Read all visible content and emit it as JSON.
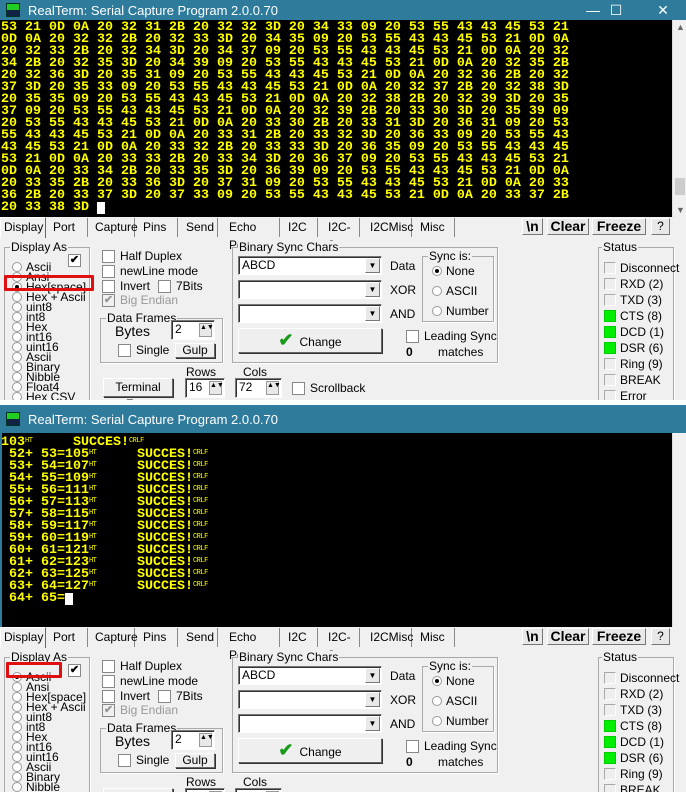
{
  "colors": {
    "titlebar": "#2e7b9c",
    "terminal_bg": "#000000",
    "terminal_fg": "#ffff00",
    "led_on": "#00e000",
    "highlight": "#e01010"
  },
  "window_controls": {
    "minimize": "—",
    "maximize": "☐",
    "close": "✕"
  },
  "tabs": [
    "Display",
    "Port",
    "Capture",
    "Pins",
    "Send",
    "Echo Port",
    "I2C",
    "I2C-2",
    "I2CMisc",
    "Misc"
  ],
  "toolbar": {
    "newline": "\\n",
    "clear": "Clear",
    "freeze": "Freeze",
    "help": "?"
  },
  "display_as": {
    "legend": "Display As",
    "options": [
      "Ascii",
      "Ansi",
      "Hex[space]",
      "Hex + Ascii",
      "uint8",
      "int8",
      "Hex",
      "int16",
      "uint16",
      "Ascii",
      "Binary",
      "Nibble",
      "Float4",
      "Hex CSV"
    ]
  },
  "options": {
    "half_duplex": "Half Duplex",
    "newline_mode": "newLine mode",
    "invert": "Invert",
    "seven_bits": "7Bits",
    "big_endian": "Big Endian"
  },
  "data_frames": {
    "legend": "Data Frames",
    "bytes_label": "Bytes",
    "bytes_value": "2",
    "single": "Single",
    "gulp": "Gulp"
  },
  "terminal": {
    "font_button": "Terminal Font",
    "rows_label": "Rows",
    "rows_value": "16",
    "cols_label": "Cols",
    "cols_value": "72",
    "scrollback": "Scrollback"
  },
  "binary_sync": {
    "legend": "Binary Sync Chars",
    "data_value": "ABCD",
    "xor_value": "",
    "and_value": "",
    "data_label": "Data",
    "xor_label": "XOR",
    "and_label": "AND",
    "change": "Change",
    "sync_legend": "Sync is:",
    "sync_options": [
      "None",
      "ASCII",
      "Number"
    ],
    "sync_selected": 0,
    "leading_sync": "Leading Sync",
    "matches_count": "0",
    "matches_label": "matches"
  },
  "status": {
    "legend": "Status",
    "items": [
      {
        "label": "Disconnect",
        "on": false
      },
      {
        "label": "RXD (2)",
        "on": false
      },
      {
        "label": "TXD (3)",
        "on": false
      },
      {
        "label": "CTS (8)",
        "on": true
      },
      {
        "label": "DCD (1)",
        "on": true
      },
      {
        "label": "DSR (6)",
        "on": true
      },
      {
        "label": "Ring (9)",
        "on": false
      },
      {
        "label": "BREAK",
        "on": false
      },
      {
        "label": "Error",
        "on": false
      }
    ]
  },
  "windows": [
    {
      "title": "RealTerm: Serial Capture Program 2.0.0.70",
      "display_selected": 2,
      "display_checkbox": true,
      "hex_lines": [
        "53 21 0D 0A 20 32 31 2B 20 32 32 3D 20 34 33 09 20 53 55 43 43 45 53 21",
        "0D 0A 20 32 32 2B 20 32 33 3D 20 34 35 09 20 53 55 43 43 45 53 21 0D 0A",
        "20 32 33 2B 20 32 34 3D 20 34 37 09 20 53 55 43 43 45 53 21 0D 0A 20 32",
        "34 2B 20 32 35 3D 20 34 39 09 20 53 55 43 43 45 53 21 0D 0A 20 32 35 2B",
        "20 32 36 3D 20 35 31 09 20 53 55 43 43 45 53 21 0D 0A 20 32 36 2B 20 32",
        "37 3D 20 35 33 09 20 53 55 43 43 45 53 21 0D 0A 20 32 37 2B 20 32 38 3D",
        "20 35 35 09 20 53 55 43 43 45 53 21 0D 0A 20 32 38 2B 20 32 39 3D 20 35",
        "37 09 20 53 55 43 43 45 53 21 0D 0A 20 32 39 2B 20 33 30 3D 20 35 39 09",
        "20 53 55 43 43 45 53 21 0D 0A 20 33 30 2B 20 33 31 3D 20 36 31 09 20 53",
        "55 43 43 45 53 21 0D 0A 20 33 31 2B 20 33 32 3D 20 36 33 09 20 53 55 43",
        "43 45 53 21 0D 0A 20 33 32 2B 20 33 33 3D 20 36 35 09 20 53 55 43 43 45",
        "53 21 0D 0A 20 33 33 2B 20 33 34 3D 20 36 37 09 20 53 55 43 43 45 53 21",
        "0D 0A 20 33 34 2B 20 33 35 3D 20 36 39 09 20 53 55 43 43 45 53 21 0D 0A",
        "20 33 35 2B 20 33 36 3D 20 37 31 09 20 53 55 43 43 45 53 21 0D 0A 20 33",
        "36 2B 20 33 37 3D 20 37 33 09 20 53 55 43 43 45 53 21 0D 0A 20 33 37 2B",
        "20 33 38 3D "
      ]
    },
    {
      "title": "RealTerm: Serial Capture Program 2.0.0.70",
      "display_selected": 0,
      "display_checkbox": true,
      "ascii_lines": [
        [
          "103",
          "HT",
          "     SUCCES!",
          "CRLF"
        ],
        [
          " 52+ 53=105",
          "HT",
          "     SUCCES!",
          "CRLF"
        ],
        [
          " 53+ 54=107",
          "HT",
          "     SUCCES!",
          "CRLF"
        ],
        [
          " 54+ 55=109",
          "HT",
          "     SUCCES!",
          "CRLF"
        ],
        [
          " 55+ 56=111",
          "HT",
          "     SUCCES!",
          "CRLF"
        ],
        [
          " 56+ 57=113",
          "HT",
          "     SUCCES!",
          "CRLF"
        ],
        [
          " 57+ 58=115",
          "HT",
          "     SUCCES!",
          "CRLF"
        ],
        [
          " 58+ 59=117",
          "HT",
          "     SUCCES!",
          "CRLF"
        ],
        [
          " 59+ 60=119",
          "HT",
          "     SUCCES!",
          "CRLF"
        ],
        [
          " 60+ 61=121",
          "HT",
          "     SUCCES!",
          "CRLF"
        ],
        [
          " 61+ 62=123",
          "HT",
          "     SUCCES!",
          "CRLF"
        ],
        [
          " 62+ 63=125",
          "HT",
          "     SUCCES!",
          "CRLF"
        ],
        [
          " 63+ 64=127",
          "HT",
          "     SUCCES!",
          "CRLF"
        ],
        [
          " 64+ 65="
        ]
      ]
    }
  ]
}
